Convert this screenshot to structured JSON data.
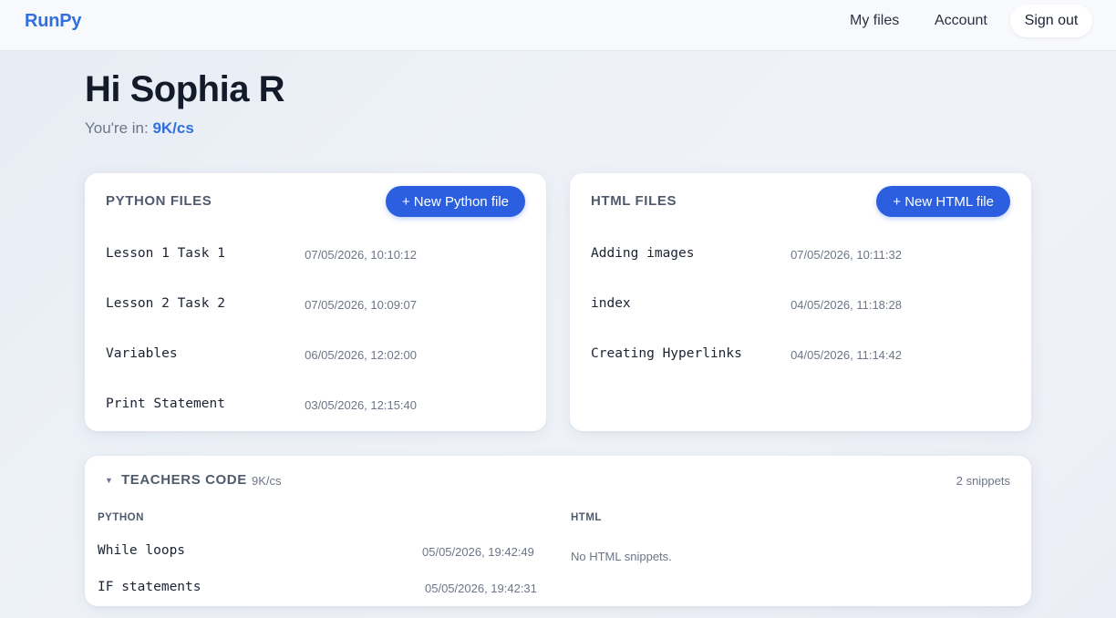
{
  "nav": {
    "brand": "RunPy",
    "my_files": "My files",
    "account": "Account",
    "sign_out": "Sign out"
  },
  "greeting": {
    "title": "Hi Sophia R",
    "location_prefix": "You're in: ",
    "group": "9K/cs"
  },
  "python_files": {
    "title": "PYTHON FILES",
    "new_button": "+ New Python file",
    "items": [
      {
        "name": "Lesson 1 Task 1",
        "date": "07/05/2026, 10:10:12"
      },
      {
        "name": "Lesson 2 Task 2",
        "date": "07/05/2026, 10:09:07"
      },
      {
        "name": "Variables",
        "date": "06/05/2026, 12:02:00"
      },
      {
        "name": "Print Statement",
        "date": "03/05/2026, 12:15:40"
      }
    ]
  },
  "html_files": {
    "title": "HTML FILES",
    "new_button": "+ New HTML file",
    "items": [
      {
        "name": "Adding images",
        "date": "07/05/2026, 10:11:32"
      },
      {
        "name": "index",
        "date": "04/05/2026, 11:18:28"
      },
      {
        "name": "Creating Hyperlinks",
        "date": "04/05/2026, 11:14:42"
      }
    ]
  },
  "teachers_code": {
    "toggle_glyph": "▼",
    "title": "TEACHERS CODE",
    "group": "9K/cs",
    "count": "2 snippets",
    "python_header": "PYTHON",
    "html_header": "HTML",
    "python_items": [
      {
        "name": "While loops",
        "date": "05/05/2026, 19:42:49"
      },
      {
        "name": "IF statements",
        "date": "05/05/2026, 19:42:31"
      }
    ],
    "html_empty": "No HTML snippets."
  },
  "colors": {
    "accent": "#2f6fe0",
    "button": "#2c5fe0",
    "muted_text": "#6c7688",
    "heading": "#131a2a"
  }
}
